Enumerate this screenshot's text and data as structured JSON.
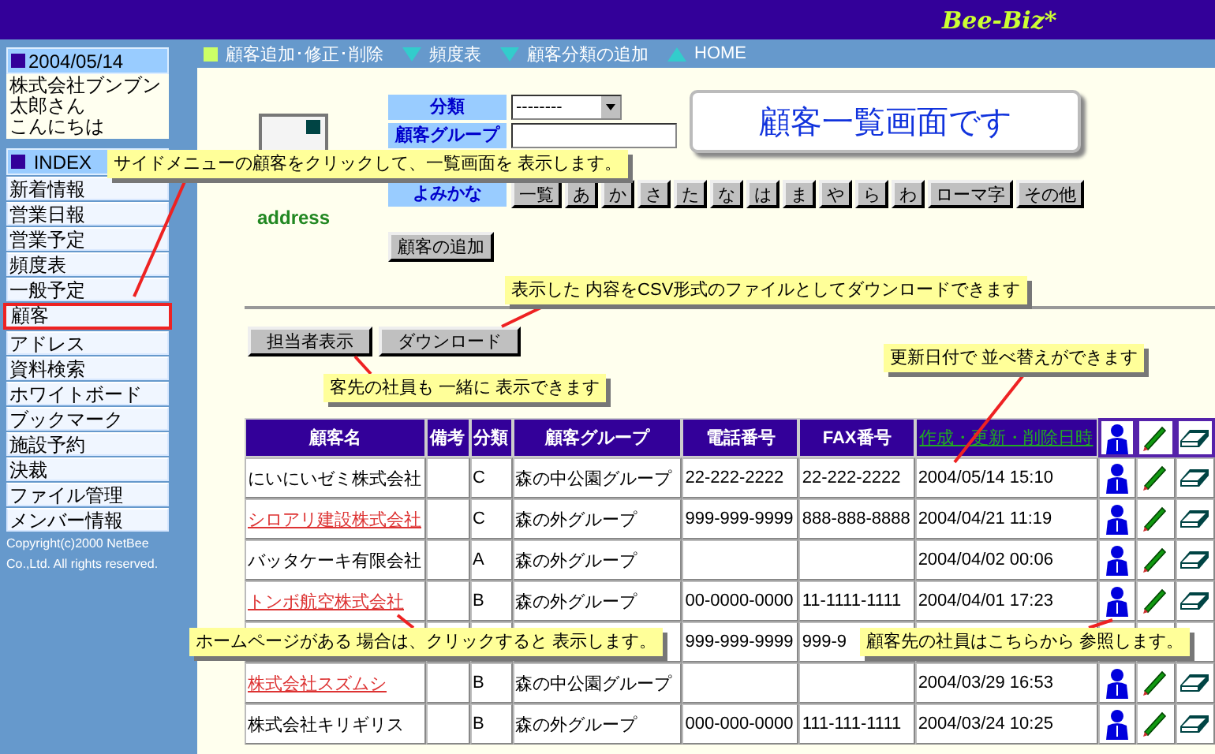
{
  "header": {
    "logo": "Bee-Biz*"
  },
  "nav": [
    {
      "label": "顧客追加･修正･削除",
      "kind": "square"
    },
    {
      "label": "頻度表",
      "kind": "down"
    },
    {
      "label": "顧客分類の追加",
      "kind": "down"
    },
    {
      "label": "HOME",
      "kind": "up"
    }
  ],
  "sidebar": {
    "date": "2004/05/14",
    "greeting": [
      "株式会社ブンブン",
      "太郎さん",
      "こんにちは"
    ],
    "index_title": "INDEX",
    "items": [
      {
        "label": "新着情報",
        "selected": false
      },
      {
        "label": "営業日報",
        "selected": false
      },
      {
        "label": "営業予定",
        "selected": false
      },
      {
        "label": "頻度表",
        "selected": false
      },
      {
        "label": "一般予定",
        "selected": false
      },
      {
        "label": "顧客",
        "selected": true
      },
      {
        "label": "アドレス",
        "selected": false
      },
      {
        "label": "資料検索",
        "selected": false
      },
      {
        "label": "ホワイトボード",
        "selected": false
      },
      {
        "label": "ブックマーク",
        "selected": false
      },
      {
        "label": "施設予約",
        "selected": false
      },
      {
        "label": "決裁",
        "selected": false
      },
      {
        "label": "ファイル管理",
        "selected": false
      },
      {
        "label": "メンバー情報",
        "selected": false
      }
    ],
    "copyright": [
      "Copyright(c)2000 NetBee",
      "Co.,Ltd. All rights reserved."
    ]
  },
  "logo_caption": "address",
  "filters": {
    "category_label": "分類",
    "category_value": "--------",
    "group_label": "顧客グループ",
    "reading_label": "よみかな",
    "kana_buttons": [
      "一覧",
      "あ",
      "か",
      "さ",
      "た",
      "な",
      "は",
      "ま",
      "や",
      "ら",
      "わ",
      "ローマ字",
      "その他"
    ]
  },
  "add_button": "顧客の追加",
  "actions": [
    "担当者表示",
    "ダウンロード"
  ],
  "table": {
    "columns": [
      {
        "label": "顧客名",
        "link": false
      },
      {
        "label": "備考",
        "link": false
      },
      {
        "label": "分類",
        "link": false
      },
      {
        "label": "顧客グループ",
        "link": false
      },
      {
        "label": "電話番号",
        "link": false
      },
      {
        "label": "FAX番号",
        "link": false
      },
      {
        "label": "作成・更新・削除日時",
        "link": true
      }
    ],
    "rows": [
      {
        "icons": true,
        "link": false,
        "name": "にいにいゼミ株式会社",
        "category": "C",
        "group": "森の中公園グループ",
        "phone": "22-222-2222",
        "fax": "22-222-2222",
        "updated": "2004/05/14 15:10"
      },
      {
        "icons": true,
        "link": true,
        "name": "シロアリ建設株式会社",
        "category": "C",
        "group": "森の外グループ",
        "phone": "999-999-9999",
        "fax": "888-888-8888",
        "updated": "2004/04/21 11:19"
      },
      {
        "icons": true,
        "link": false,
        "name": "バッタケーキ有限会社",
        "category": "A",
        "group": "森の外グループ",
        "updated": "2004/04/02 00:06"
      },
      {
        "icons": true,
        "link": true,
        "name": "トンボ航空株式会社",
        "category": "B",
        "group": "森の外グループ",
        "phone": "00-0000-0000",
        "fax": "11-1111-1111",
        "updated": "2004/04/01 17:23"
      },
      {
        "icons": false,
        "phone": "999-999-9999",
        "fax": "999-9"
      },
      {
        "icons": true,
        "link": true,
        "name": "株式会社スズムシ",
        "category": "B",
        "group": "森の中公園グループ",
        "updated": "2004/03/29 16:53"
      },
      {
        "icons": true,
        "link": false,
        "name": "株式会社キリギリス",
        "category": "B",
        "group": "森の外グループ",
        "phone": "000-000-0000",
        "fax": "111-111-1111",
        "updated": "2004/03/24 10:25"
      }
    ]
  },
  "title_panel": "顧客一覧画面です",
  "callouts": [
    "サイドメニューの顧客をクリックして、一覧画面を 表示します。",
    "表示した 内容をCSV形式のファイルとしてダウンロードできます",
    "客先の社員も 一緒に 表示できます",
    "更新日付で 並べ替えができます",
    "ホームページがある 場合は、クリックすると 表示します。",
    "顧客先の社員はこちらから 参照します。"
  ]
}
